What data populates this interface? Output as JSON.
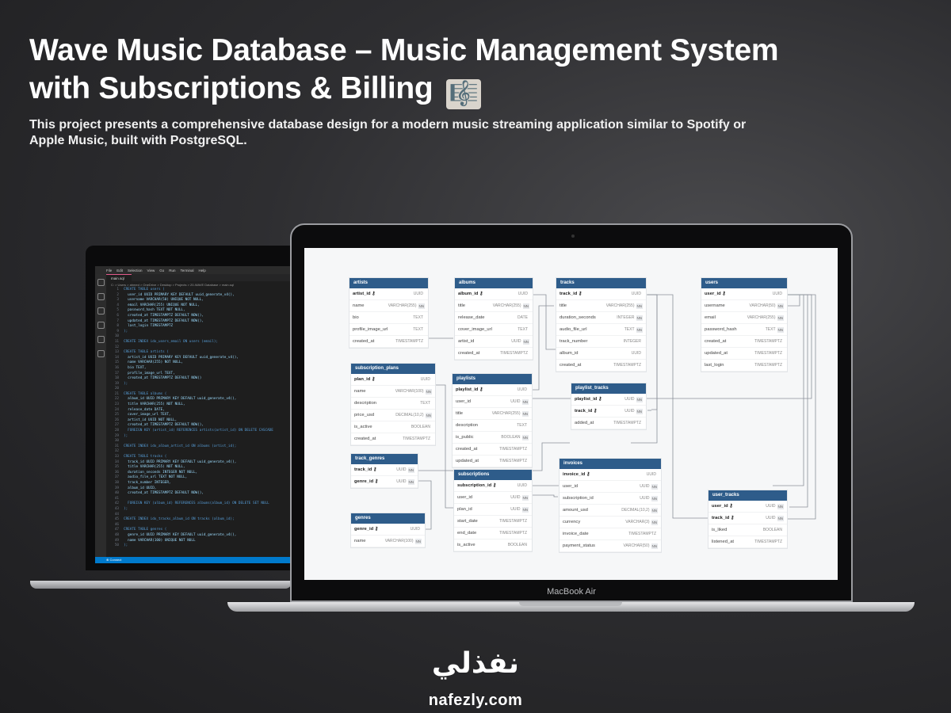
{
  "hero": {
    "title": "Wave Music Database – Music Management System with Subscriptions & Billing",
    "emoji": "🎼",
    "description": "This project presents a comprehensive database design for a modern music streaming application similar to Spotify or Apple Music, built with PostgreSQL."
  },
  "vscode": {
    "menu": [
      "File",
      "Edit",
      "Selection",
      "View",
      "Go",
      "Run",
      "Terminal",
      "Help"
    ],
    "tab": "main.sql",
    "breadcrumb": "C: > Users > ahmed > OneDrive > Desktop > Projects > 20-WAVE Database > main.sql",
    "code": [
      "CREATE TABLE users (",
      "  user_id UUID PRIMARY KEY DEFAULT uuid_generate_v4(),",
      "  username VARCHAR(50) UNIQUE NOT NULL,",
      "  email VARCHAR(255) UNIQUE NOT NULL,",
      "  password_hash TEXT NOT NULL,",
      "  created_at TIMESTAMPTZ DEFAULT NOW(),",
      "  updated_at TIMESTAMPTZ DEFAULT NOW(),",
      "  last_login TIMESTAMPTZ",
      ");",
      "",
      "CREATE INDEX idx_users_email ON users (email);",
      "",
      "CREATE TABLE artists (",
      "  artist_id UUID PRIMARY KEY DEFAULT uuid_generate_v4(),",
      "  name VARCHAR(255) NOT NULL,",
      "  bio TEXT,",
      "  profile_image_url TEXT,",
      "  created_at TIMESTAMPTZ DEFAULT NOW()",
      ");",
      "",
      "CREATE TABLE albums (",
      "  album_id UUID PRIMARY KEY DEFAULT uuid_generate_v4(),",
      "  title VARCHAR(255) NOT NULL,",
      "  release_date DATE,",
      "  cover_image_url TEXT,",
      "  artist_id UUID NOT NULL,",
      "  created_at TIMESTAMPTZ DEFAULT NOW(),",
      "  FOREIGN KEY (artist_id) REFERENCES artists(artist_id) ON DELETE CASCADE",
      ");",
      "",
      "CREATE INDEX idx_album_artist_id ON albums (artist_id);",
      "",
      "CREATE TABLE tracks (",
      "  track_id UUID PRIMARY KEY DEFAULT uuid_generate_v4(),",
      "  title VARCHAR(255) NOT NULL,",
      "  duration_seconds INTEGER NOT NULL,",
      "  audio_file_url TEXT NOT NULL,",
      "  track_number INTEGER,",
      "  album_id UUID,",
      "  created_at TIMESTAMPTZ DEFAULT NOW(),",
      "",
      "  FOREIGN KEY (album_id) REFERENCES albums(album_id) ON DELETE SET NULL",
      ");",
      "",
      "CREATE INDEX idx_tracks_album_id ON tracks (album_id);",
      "",
      "CREATE TABLE genres (",
      "  genre_id UUID PRIMARY KEY DEFAULT uuid_generate_v4(),",
      "  name VARCHAR(100) UNIQUE NOT NULL",
      ");"
    ],
    "status": "Connect"
  },
  "laptop_label": "MacBook Air",
  "schema": {
    "tables": [
      {
        "name": "artists",
        "rows": [
          [
            "artist_id",
            "UUID",
            ""
          ],
          [
            "name",
            "VARCHAR(255)",
            "NN"
          ],
          [
            "bio",
            "TEXT",
            ""
          ],
          [
            "profile_image_url",
            "TEXT",
            ""
          ],
          [
            "created_at",
            "TIMESTAMPTZ",
            ""
          ]
        ]
      },
      {
        "name": "albums",
        "rows": [
          [
            "album_id",
            "UUID",
            ""
          ],
          [
            "title",
            "VARCHAR(255)",
            "NN"
          ],
          [
            "release_date",
            "DATE",
            ""
          ],
          [
            "cover_image_url",
            "TEXT",
            ""
          ],
          [
            "artist_id",
            "UUID",
            "NN"
          ],
          [
            "created_at",
            "TIMESTAMPTZ",
            ""
          ]
        ]
      },
      {
        "name": "tracks",
        "rows": [
          [
            "track_id",
            "UUID",
            ""
          ],
          [
            "title",
            "VARCHAR(255)",
            "NN"
          ],
          [
            "duration_seconds",
            "INTEGER",
            "NN"
          ],
          [
            "audio_file_url",
            "TEXT",
            "NN"
          ],
          [
            "track_number",
            "INTEGER",
            ""
          ],
          [
            "album_id",
            "UUID",
            ""
          ],
          [
            "created_at",
            "TIMESTAMPTZ",
            ""
          ]
        ]
      },
      {
        "name": "users",
        "rows": [
          [
            "user_id",
            "UUID",
            ""
          ],
          [
            "username",
            "VARCHAR(50)",
            "NN"
          ],
          [
            "email",
            "VARCHAR(255)",
            "NN"
          ],
          [
            "password_hash",
            "TEXT",
            "NN"
          ],
          [
            "created_at",
            "TIMESTAMPTZ",
            ""
          ],
          [
            "updated_at",
            "TIMESTAMPTZ",
            ""
          ],
          [
            "last_login",
            "TIMESTAMPTZ",
            ""
          ]
        ]
      },
      {
        "name": "subscription_plans",
        "rows": [
          [
            "plan_id",
            "UUID",
            ""
          ],
          [
            "name",
            "VARCHAR(100)",
            "NN"
          ],
          [
            "description",
            "TEXT",
            ""
          ],
          [
            "price_usd",
            "DECIMAL(10,2)",
            "NN"
          ],
          [
            "is_active",
            "BOOLEAN",
            ""
          ],
          [
            "created_at",
            "TIMESTAMPTZ",
            ""
          ]
        ]
      },
      {
        "name": "playlists",
        "rows": [
          [
            "playlist_id",
            "UUID",
            ""
          ],
          [
            "user_id",
            "UUID",
            "NN"
          ],
          [
            "title",
            "VARCHAR(255)",
            "NN"
          ],
          [
            "description",
            "TEXT",
            ""
          ],
          [
            "is_public",
            "BOOLEAN",
            "NN"
          ],
          [
            "created_at",
            "TIMESTAMPTZ",
            ""
          ],
          [
            "updated_at",
            "TIMESTAMPTZ",
            ""
          ]
        ]
      },
      {
        "name": "playlist_tracks",
        "rows": [
          [
            "playlist_id",
            "UUID",
            "NN"
          ],
          [
            "track_id",
            "UUID",
            "NN"
          ],
          [
            "added_at",
            "TIMESTAMPTZ",
            ""
          ]
        ]
      },
      {
        "name": "track_genres",
        "rows": [
          [
            "track_id",
            "UUID",
            "NN"
          ],
          [
            "genre_id",
            "UUID",
            "NN"
          ]
        ]
      },
      {
        "name": "subscriptions",
        "rows": [
          [
            "subscription_id",
            "UUID",
            ""
          ],
          [
            "user_id",
            "UUID",
            "NN"
          ],
          [
            "plan_id",
            "UUID",
            "NN"
          ],
          [
            "start_date",
            "TIMESTAMPTZ",
            ""
          ],
          [
            "end_date",
            "TIMESTAMPTZ",
            ""
          ],
          [
            "is_active",
            "BOOLEAN",
            ""
          ]
        ]
      },
      {
        "name": "invoices",
        "rows": [
          [
            "invoice_id",
            "UUID",
            ""
          ],
          [
            "user_id",
            "UUID",
            "NN"
          ],
          [
            "subscription_id",
            "UUID",
            "NN"
          ],
          [
            "amount_usd",
            "DECIMAL(10,2)",
            "NN"
          ],
          [
            "currency",
            "VARCHAR(3)",
            "NN"
          ],
          [
            "invoice_date",
            "TIMESTAMPTZ",
            ""
          ],
          [
            "payment_status",
            "VARCHAR(50)",
            "NN"
          ]
        ]
      },
      {
        "name": "genres",
        "rows": [
          [
            "genre_id",
            "UUID",
            ""
          ],
          [
            "name",
            "VARCHAR(100)",
            "NN"
          ]
        ]
      },
      {
        "name": "user_tracks",
        "rows": [
          [
            "user_id",
            "UUID",
            "NN"
          ],
          [
            "track_id",
            "UUID",
            "NN"
          ],
          [
            "is_liked",
            "BOOLEAN",
            ""
          ],
          [
            "listened_at",
            "TIMESTAMPTZ",
            ""
          ]
        ]
      }
    ]
  },
  "logo": {
    "arabic": "نفذلي",
    "url": "nafezly.com"
  }
}
